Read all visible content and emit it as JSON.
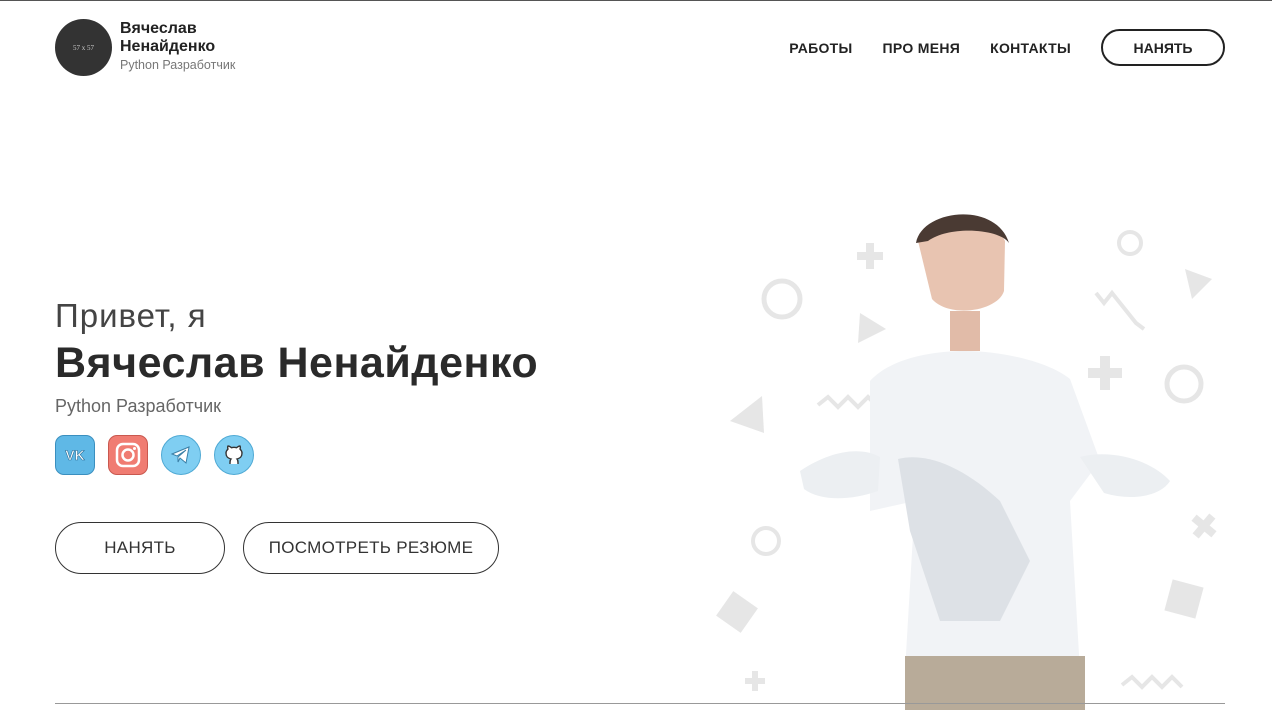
{
  "header": {
    "avatar_placeholder": "57 x 57",
    "name": "Вячеслав Ненайденко",
    "role": "Python Разработчик",
    "nav": [
      "РАБОТЫ",
      "ПРО МЕНЯ",
      "КОНТАКТЫ"
    ],
    "hire_label": "НАНЯТЬ"
  },
  "hero": {
    "greeting": "Привет, я",
    "name": "Вячеслав Ненайденко",
    "role": "Python Разработчик",
    "socials": [
      "vk-icon",
      "instagram-icon",
      "telegram-icon",
      "github-icon"
    ],
    "hire_button": "НАНЯТЬ",
    "resume_button": "ПОСМОТРЕТЬ РЕЗЮМЕ"
  },
  "colors": {
    "text": "#2d2d2d",
    "vk": "#5fb8e6",
    "instagram": "#f07c72",
    "telegram": "#7fcef2",
    "github": "#7fcef2",
    "decor": "#e6e6e6"
  }
}
